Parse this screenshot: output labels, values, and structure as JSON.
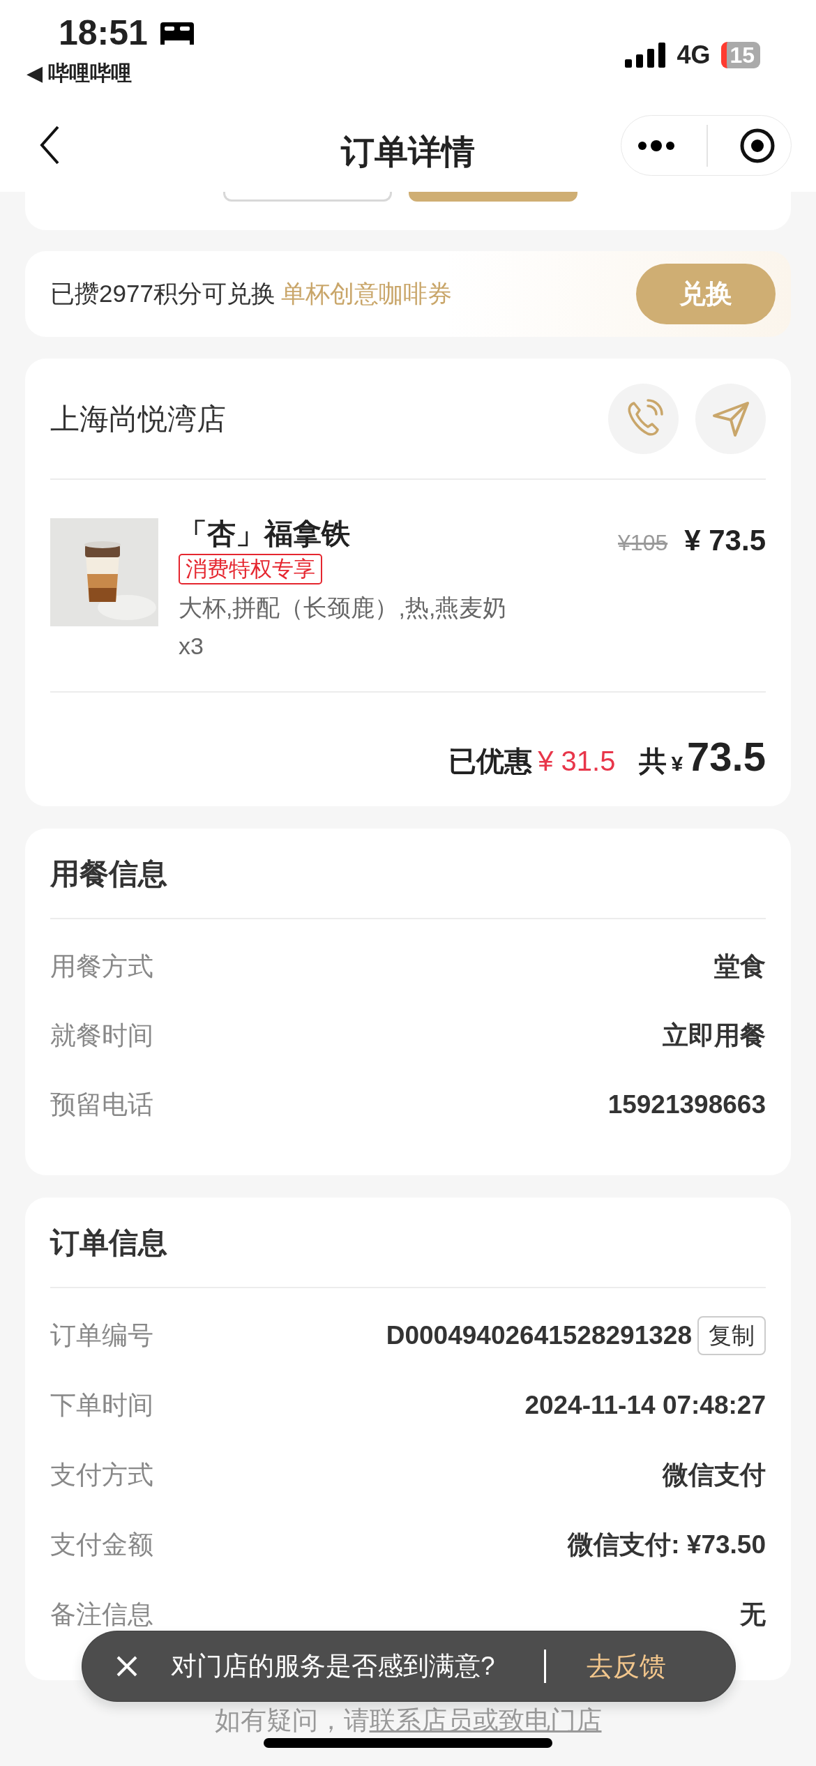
{
  "status_bar": {
    "time": "18:51",
    "back_app": "◀ 哔哩哔哩",
    "network": "4G",
    "battery": "15"
  },
  "nav": {
    "title": "订单详情"
  },
  "top_card": {
    "buttons": [
      {
        "kind": "outline"
      },
      {
        "kind": "filled"
      }
    ]
  },
  "points_banner": {
    "text": "已攒2977积分可兑换",
    "highlight": "单杯创意咖啡券",
    "button": "兑换"
  },
  "store": {
    "name": "上海尚悦湾店",
    "items": [
      {
        "kind": "picture",
        "name": "「杏」福拿铁",
        "tag": "消费特权专享",
        "specs": "大杯,拼配（长颈鹿）,热,燕麦奶",
        "quantity": "x3",
        "original_price": "¥105",
        "price": "¥ 73.5"
      }
    ],
    "discount_label": "已优惠",
    "discount": "¥ 31.5",
    "total_label": "共",
    "currency": "¥",
    "total": "73.5"
  },
  "dining_info": {
    "title": "用餐信息",
    "rows": [
      {
        "label": "用餐方式",
        "value": "堂食"
      },
      {
        "label": "就餐时间",
        "value": "立即用餐"
      },
      {
        "label": "预留电话",
        "value": "15921398663"
      }
    ]
  },
  "order_info": {
    "title": "订单信息",
    "rows": [
      {
        "label": "订单编号",
        "value": "D00049402641528291328",
        "action": "复制"
      },
      {
        "label": "下单时间",
        "value": "2024-11-14 07:48:27"
      },
      {
        "label": "支付方式",
        "value": "微信支付"
      },
      {
        "label": "支付金额",
        "value": "微信支付: ¥73.50"
      },
      {
        "label": "备注信息",
        "value": "无"
      }
    ]
  },
  "toast": {
    "message": "对门店的服务是否感到满意?",
    "action": "去反馈"
  },
  "footer": {
    "prefix": "如有疑问，请",
    "link": "联系店员或致电门店"
  }
}
